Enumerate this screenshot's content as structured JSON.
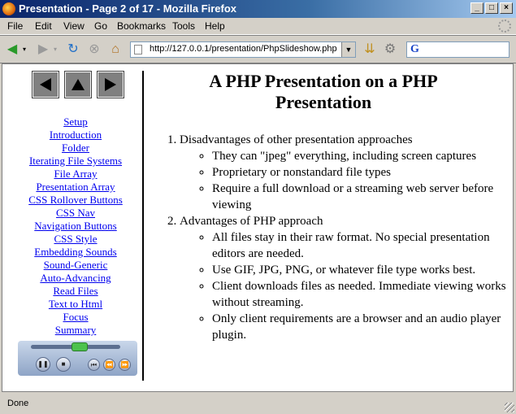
{
  "window": {
    "title": "Presentation - Page 2 of 17 - Mozilla Firefox"
  },
  "menu": [
    "File",
    "Edit",
    "View",
    "Go",
    "Bookmarks",
    "Tools",
    "Help"
  ],
  "toolbar": {
    "url": "http://127.0.0.1/presentation/PhpSlideshow.php",
    "search_engine_letter": "G"
  },
  "sidebar": {
    "nav": [
      {
        "name": "previous-arrow",
        "glyph": "◀"
      },
      {
        "name": "up-arrow",
        "glyph": "▲"
      },
      {
        "name": "next-arrow",
        "glyph": "▶"
      }
    ],
    "items": [
      "Setup",
      "Introduction",
      "Folder",
      "Iterating File Systems",
      "File Array",
      "Presentation Array",
      "CSS Rollover Buttons",
      "CSS Nav",
      "Navigation Buttons",
      "CSS Style",
      "Embedding Sounds",
      "Sound-Generic",
      "Auto-Advancing",
      "Read Files",
      "Text to Html",
      "Focus",
      "Summary"
    ]
  },
  "slide": {
    "title": "A PHP Presentation on a PHP Presentation",
    "sections": [
      {
        "heading": "Disadvantages of other presentation approaches",
        "bullets": [
          "They can \"jpeg\" everything, including screen captures",
          "Proprietary or nonstandard file types",
          "Require a full download or a streaming web server before viewing"
        ]
      },
      {
        "heading": "Advantages of PHP approach",
        "bullets": [
          "All files stay in their raw format. No special presentation editors are needed.",
          "Use GIF, JPG, PNG, or whatever file type works best.",
          "Client downloads files as needed. Immediate viewing works without streaming.",
          "Only client requirements are a browser and an audio player plugin."
        ]
      }
    ]
  },
  "status": {
    "text": "Done"
  }
}
